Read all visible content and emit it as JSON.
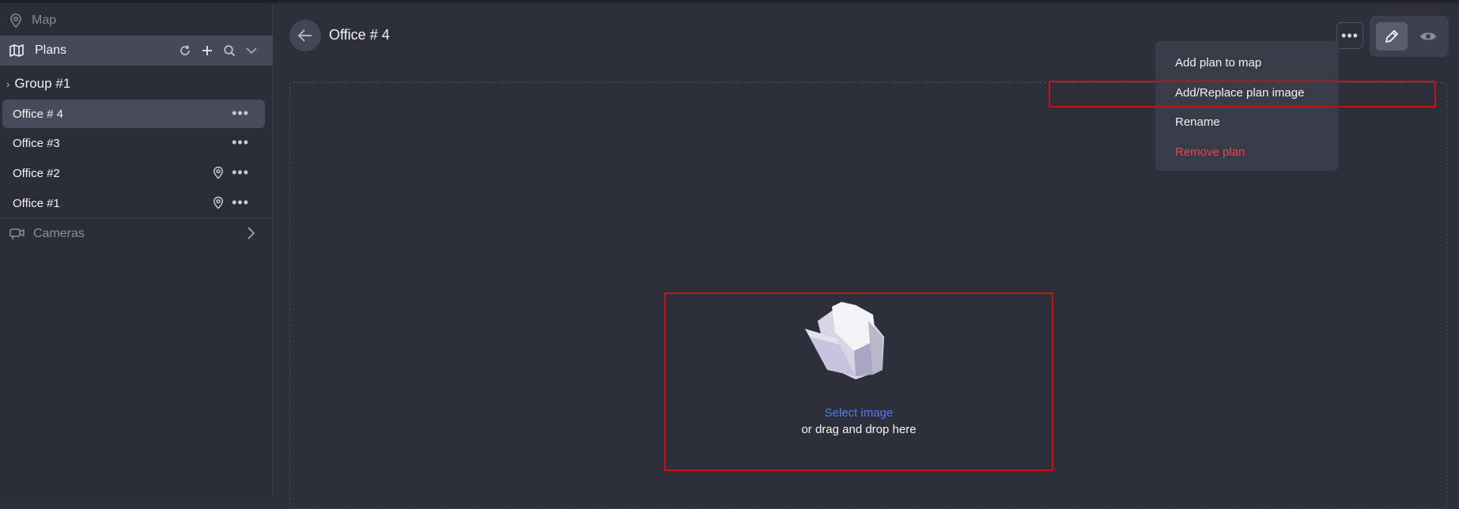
{
  "sidebar": {
    "map_label": "Map",
    "plans_label": "Plans",
    "group": {
      "label": "Group #1"
    },
    "items": [
      {
        "label": "Office # 4",
        "has_pin": false
      },
      {
        "label": "Office #3",
        "has_pin": false
      },
      {
        "label": "Office #2",
        "has_pin": true
      },
      {
        "label": "Office #1",
        "has_pin": true
      }
    ],
    "cameras_label": "Cameras",
    "icons": [
      "map-pin-icon",
      "map-icon",
      "refresh-icon",
      "plus-icon",
      "search-icon",
      "chevron-down-icon",
      "chevron-right-icon",
      "more-icon",
      "camera-icon"
    ]
  },
  "header": {
    "title": "Office # 4"
  },
  "context_menu": {
    "items": [
      {
        "label": "Add plan to map"
      },
      {
        "label": "Add/Replace plan image"
      },
      {
        "label": "Rename"
      },
      {
        "label": "Remove plan",
        "danger": true
      }
    ]
  },
  "upload": {
    "select_label": "Select image",
    "drop_hint": "or drag and drop here"
  },
  "colors": {
    "background": "#2d2f3b",
    "sidebar": "#2b2d38",
    "accent_link": "#4f7df1",
    "danger": "#e5484d",
    "highlight_box": "#d00d12"
  }
}
